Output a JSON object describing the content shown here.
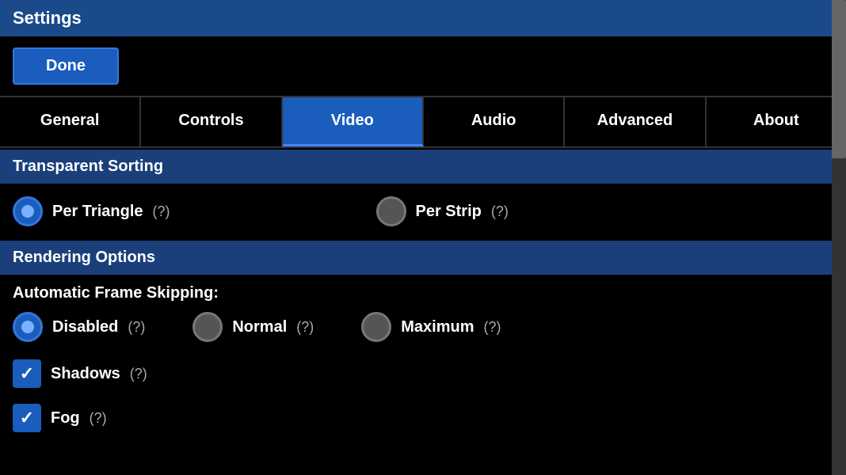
{
  "titleBar": {
    "label": "Settings"
  },
  "doneButton": {
    "label": "Done"
  },
  "tabs": [
    {
      "id": "general",
      "label": "General",
      "active": false
    },
    {
      "id": "controls",
      "label": "Controls",
      "active": false
    },
    {
      "id": "video",
      "label": "Video",
      "active": true
    },
    {
      "id": "audio",
      "label": "Audio",
      "active": false
    },
    {
      "id": "advanced",
      "label": "Advanced",
      "active": false
    },
    {
      "id": "about",
      "label": "About",
      "active": false
    }
  ],
  "sections": {
    "transparentSorting": {
      "header": "Transparent Sorting",
      "options": [
        {
          "id": "per-triangle",
          "label": "Per Triangle",
          "help": "(?)",
          "selected": true
        },
        {
          "id": "per-strip",
          "label": "Per Strip",
          "help": "(?)",
          "selected": false
        }
      ]
    },
    "renderingOptions": {
      "header": "Rendering Options",
      "afsLabel": "Automatic Frame Skipping:",
      "afsOptions": [
        {
          "id": "disabled",
          "label": "Disabled",
          "help": "(?)",
          "selected": true
        },
        {
          "id": "normal",
          "label": "Normal",
          "help": "(?)",
          "selected": false
        },
        {
          "id": "maximum",
          "label": "Maximum",
          "help": "(?)",
          "selected": false
        }
      ],
      "checkboxOptions": [
        {
          "id": "shadows",
          "label": "Shadows",
          "help": "(?)",
          "checked": true
        },
        {
          "id": "fog",
          "label": "Fog",
          "help": "(?)",
          "checked": true
        }
      ]
    }
  }
}
